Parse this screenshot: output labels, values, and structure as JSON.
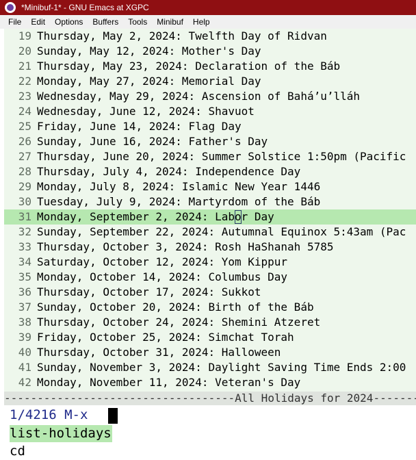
{
  "window": {
    "title": "*Minibuf-1* - GNU Emacs at XGPC"
  },
  "menu": [
    "File",
    "Edit",
    "Options",
    "Buffers",
    "Tools",
    "Minibuf",
    "Help"
  ],
  "buffer_lines": [
    {
      "n": "19",
      "t": "Thursday, May 2, 2024: Twelfth Day of Ridvan"
    },
    {
      "n": "20",
      "t": "Sunday, May 12, 2024: Mother's Day"
    },
    {
      "n": "21",
      "t": "Thursday, May 23, 2024: Declaration of the Báb"
    },
    {
      "n": "22",
      "t": "Monday, May 27, 2024: Memorial Day"
    },
    {
      "n": "23",
      "t": "Wednesday, May 29, 2024: Ascension of Bahá’u’lláh"
    },
    {
      "n": "24",
      "t": "Wednesday, June 12, 2024: Shavuot"
    },
    {
      "n": "25",
      "t": "Friday, June 14, 2024: Flag Day"
    },
    {
      "n": "26",
      "t": "Sunday, June 16, 2024: Father's Day"
    },
    {
      "n": "27",
      "t": "Thursday, June 20, 2024: Summer Solstice 1:50pm (Pacific"
    },
    {
      "n": "28",
      "t": "Thursday, July 4, 2024: Independence Day"
    },
    {
      "n": "29",
      "t": "Monday, July 8, 2024: Islamic New Year 1446"
    },
    {
      "n": "30",
      "t": "Tuesday, July 9, 2024: Martyrdom of the Báb"
    },
    {
      "n": "31",
      "t": "Monday, September 2, 2024: Labor Day"
    },
    {
      "n": "32",
      "t": "Sunday, September 22, 2024: Autumnal Equinox 5:43am (Pac"
    },
    {
      "n": "33",
      "t": "Thursday, October 3, 2024: Rosh HaShanah 5785"
    },
    {
      "n": "34",
      "t": "Saturday, October 12, 2024: Yom Kippur"
    },
    {
      "n": "35",
      "t": "Monday, October 14, 2024: Columbus Day"
    },
    {
      "n": "36",
      "t": "Thursday, October 17, 2024: Sukkot"
    },
    {
      "n": "37",
      "t": "Sunday, October 20, 2024: Birth of the Báb"
    },
    {
      "n": "38",
      "t": "Thursday, October 24, 2024: Shemini Atzeret"
    },
    {
      "n": "39",
      "t": "Friday, October 25, 2024: Simchat Torah"
    },
    {
      "n": "40",
      "t": "Thursday, October 31, 2024: Halloween"
    },
    {
      "n": "41",
      "t": "Sunday, November 3, 2024: Daylight Saving Time Ends 2:00"
    },
    {
      "n": "42",
      "t": "Monday, November 11, 2024: Veteran's Day"
    }
  ],
  "current_line": "31",
  "modeline": "-----------------------------------All Holidays for 2024-------",
  "minibuffer": {
    "prompt": "1/4216 M-x",
    "selected_candidate": "list-holidays",
    "next_candidate": "cd"
  },
  "colors": {
    "titlebar": "#8f0f12",
    "buffer_bg": "#eef7ec",
    "highlight": "#b6e8b0",
    "prompt": "#1f2a8a"
  },
  "icons": [
    "emacs-app-icon"
  ]
}
